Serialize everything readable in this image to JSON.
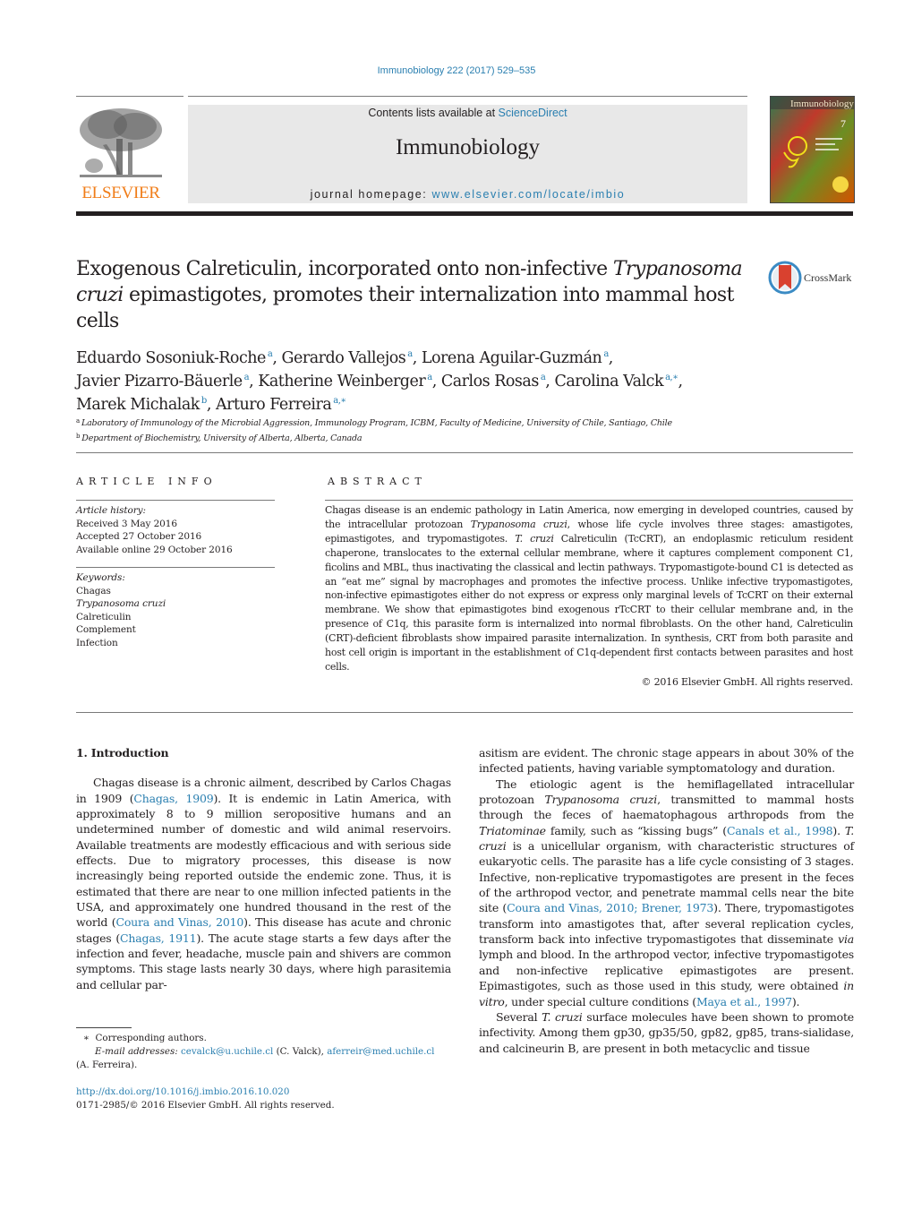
{
  "header": {
    "citation": "Immunobiology 222 (2017) 529–535",
    "contents_prefix": "Contents lists available at ",
    "contents_link": "ScienceDirect",
    "journal_name": "Immunobiology",
    "homepage_prefix": "journal homepage: ",
    "homepage_link": "www.elsevier.com/locate/imbio",
    "publisher_logo_text": "ELSEVIER",
    "cover_title": "Immunobiology",
    "cover_issue": "7"
  },
  "article": {
    "title_part1": "Exogenous Calreticulin, incorporated onto non-infective ",
    "title_italic1": "Trypanosoma cruzi",
    "title_part2": " epimastigotes, promotes their internalization into mammal host cells",
    "crossmark_label": "CrossMark",
    "authors": [
      {
        "name": "Eduardo Sosoniuk-Roche",
        "aff": "a"
      },
      {
        "name": "Gerardo Vallejos",
        "aff": "a"
      },
      {
        "name": "Lorena Aguilar-Guzmán",
        "aff": "a"
      },
      {
        "name": "Javier Pizarro-Bäuerle",
        "aff": "a"
      },
      {
        "name": "Katherine Weinberger",
        "aff": "a"
      },
      {
        "name": "Carlos Rosas",
        "aff": "a"
      },
      {
        "name": "Carolina Valck",
        "aff": "a,∗"
      },
      {
        "name": "Marek Michalak",
        "aff": "b"
      },
      {
        "name": "Arturo Ferreira",
        "aff": "a,∗"
      }
    ],
    "affiliations": [
      {
        "mark": "a",
        "text": "Laboratory of Immunology of the Microbial Aggression, Immunology Program, ICBM, Faculty of Medicine, University of Chile, Santiago, Chile"
      },
      {
        "mark": "b",
        "text": "Department of Biochemistry, University of Alberta, Alberta, Canada"
      }
    ]
  },
  "article_info": {
    "heading": "ARTICLE INFO",
    "history_label": "Article history:",
    "received": "Received 3 May 2016",
    "accepted": "Accepted 27 October 2016",
    "online": "Available online 29 October 2016",
    "keywords_label": "Keywords:",
    "keywords": [
      "Chagas",
      "Trypanosoma cruzi",
      "Calreticulin",
      "Complement",
      "Infection"
    ]
  },
  "abstract": {
    "heading": "ABSTRACT",
    "s1": "Chagas disease is an endemic pathology in Latin America, now emerging in developed countries, caused by the intracellular protozoan ",
    "i1": "Trypanosoma cruzi",
    "s2": ", whose life cycle involves three stages: amastigotes, epimastigotes, and trypomastigotes. ",
    "i2": "T. cruzi",
    "s3": " Calreticulin (TcCRT), an endoplasmic reticulum resident chaperone, translocates to the external cellular membrane, where it captures complement component C1, ficolins and MBL, thus inactivating the classical and lectin pathways. Trypomastigote-bound C1 is detected as an “eat me” signal by macrophages and promotes the infective process. Unlike infective trypomastigotes, non-infective epimastigotes either do not express or express only marginal levels of TcCRT on their external membrane. We show that epimastigotes bind exogenous rTcCRT to their cellular membrane and, in the presence of C1q, this parasite form is internalized into normal fibroblasts. On the other hand, Calreticulin (CRT)-deficient fibroblasts show impaired parasite internalization. In synthesis, CRT from both parasite and host cell origin is important in the establishment of C1q-dependent first contacts between parasites and host cells.",
    "copyright": "© 2016 Elsevier GmbH. All rights reserved."
  },
  "body": {
    "section_heading": "1.  Introduction",
    "p1_a": "Chagas disease is a chronic ailment, described by Carlos Chagas in 1909 (",
    "p1_ref1": "Chagas, 1909",
    "p1_b": "). It is endemic in Latin America, with approximately 8 to 9 million seropositive humans and an undetermined number of domestic and wild animal reservoirs. Available treatments are modestly efficacious and with serious side effects. Due to migratory processes, this disease is now increasingly being reported outside the endemic zone. Thus, it is estimated that there are near to one million infected patients in the USA, and approximately one hundred thousand in the rest of the world (",
    "p1_ref2": "Coura and Vinas, 2010",
    "p1_c": "). This disease has acute and chronic stages (",
    "p1_ref3": "Chagas, 1911",
    "p1_d": "). The acute stage starts a few days after the infection and fever, headache, muscle pain and shivers are common symptoms. This stage lasts nearly 30 days, where high parasitemia and cellular parasitism are evident. The chronic stage appears in about 30% of the infected patients, having variable symptomatology and duration.",
    "p2_a": "The etiologic agent is the hemiflagellated intracellular protozoan ",
    "p2_i1": "Trypanosoma cruzi",
    "p2_b": ", transmitted to mammal hosts through the feces of haematophagous arthropods from the ",
    "p2_i2": "Triatominae",
    "p2_c": " family, such as “kissing bugs” (",
    "p2_ref1": "Canals et al., 1998",
    "p2_d": "). ",
    "p2_i3": "T. cruzi",
    "p2_e": " is a unicellular organism, with characteristic structures of eukaryotic cells. The parasite has a life cycle consisting of 3 stages. Infective, non-replicative trypomastigotes are present in the feces of the arthropod vector, and penetrate mammal cells near the bite site (",
    "p2_ref2": "Coura and Vinas, 2010; Brener, 1973",
    "p2_f": "). There, trypomastigotes transform into amastigotes that, after several replication cycles, transform back into infective trypomastigotes that disseminate ",
    "p2_i4": "via",
    "p2_g": " lymph and blood. In the arthropod vector, infective trypomastigotes and non-infective replicative epimastigotes are present. Epimastigotes, such as those used in this study, were obtained ",
    "p2_i5": "in vitro",
    "p2_h": ", under special culture conditions (",
    "p2_ref3": "Maya et al., 1997",
    "p2_j": ").",
    "p3_a": "Several ",
    "p3_i1": "T. cruzi",
    "p3_b": " surface molecules have been shown to promote infectivity. Among them gp30, gp35/50, gp82, gp85, trans-sialidase, and calcineurin B, are present in both metacyclic and tissue"
  },
  "footnotes": {
    "star": "∗",
    "corresponding": "Corresponding authors.",
    "email_label": "E-mail addresses:",
    "email1": "cevalck@u.uchile.cl",
    "email1_name": " (C. Valck), ",
    "email2": "aferreir@med.uchile.cl",
    "email2_name": "(A. Ferreira).",
    "doi": "http://dx.doi.org/10.1016/j.imbio.2016.10.020",
    "issn": "0171-2985/© 2016 Elsevier GmbH. All rights reserved."
  },
  "colors": {
    "link": "#2a7fb0",
    "elsevier_orange": "#f07d19",
    "banner_bg": "#e8e8e8",
    "text": "#231f20"
  }
}
